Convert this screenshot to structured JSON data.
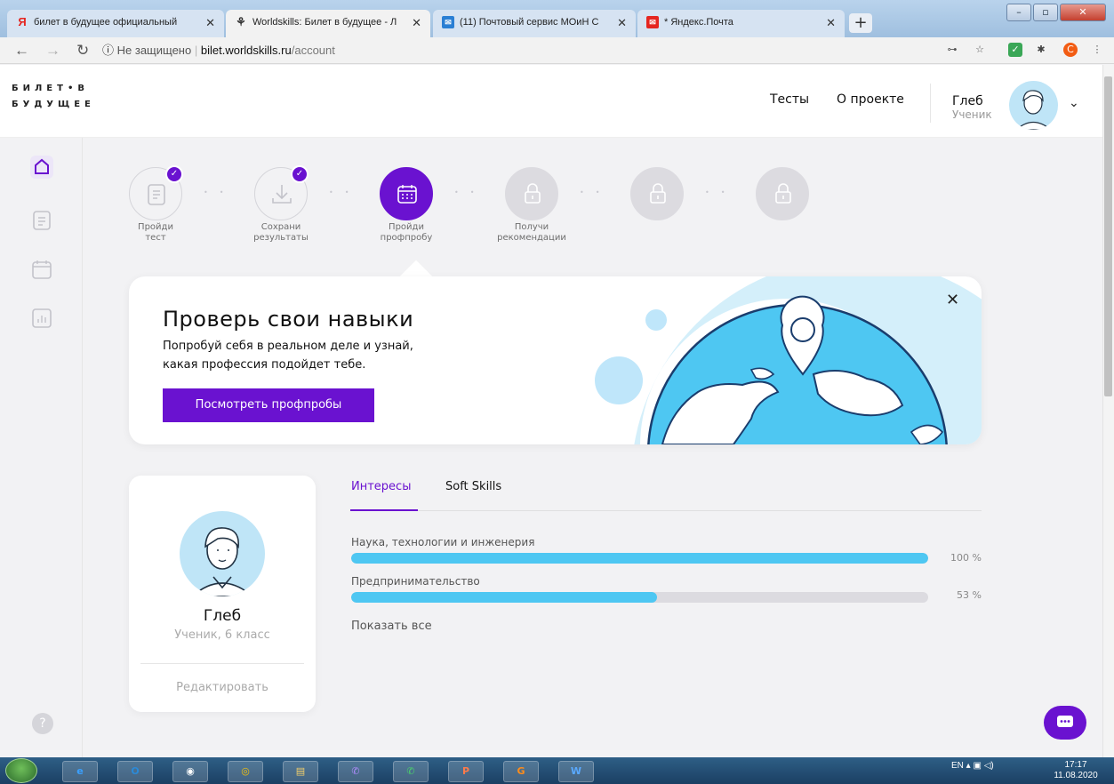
{
  "browser": {
    "tabs": [
      {
        "title": "билет в будущее официальный",
        "icon": "yandex-icon"
      },
      {
        "title": "Worldskills: Билет в будущее - Л",
        "icon": "worldskills-icon"
      },
      {
        "title": "(11) Почтовый сервис МОиН С",
        "icon": "mail-icon"
      },
      {
        "title": "* Яндекс.Почта",
        "icon": "yandex-mail-icon"
      }
    ],
    "address": {
      "security": "Не защищено",
      "host": "bilet.worldskills.ru",
      "path": "/account"
    }
  },
  "site": {
    "logo_line1": "БИЛЕТ•В",
    "logo_line2": "БУДУЩЕЕ",
    "nav": {
      "tests": "Тесты",
      "about": "О проекте"
    },
    "user": {
      "name": "Глеб",
      "role": "Ученик"
    }
  },
  "steps": [
    {
      "label1": "Пройди",
      "label2": "тест",
      "status": "done"
    },
    {
      "label1": "Сохрани",
      "label2": "результаты",
      "status": "done"
    },
    {
      "label1": "Пройди",
      "label2": "профпробу",
      "status": "current"
    },
    {
      "label1": "Получи",
      "label2": "рекомендации",
      "status": "locked"
    },
    {
      "label1": "",
      "label2": "",
      "status": "locked"
    },
    {
      "label1": "",
      "label2": "",
      "status": "locked"
    }
  ],
  "banner": {
    "title": "Проверь свои навыки",
    "text_line1": "Попробуй себя в реальном деле и узнай,",
    "text_line2": "какая профессия подойдет тебе.",
    "button": "Посмотреть профпробы"
  },
  "profile": {
    "name": "Глеб",
    "role": "Ученик, 6 класс",
    "edit": "Редактировать"
  },
  "tabs": {
    "interests": "Интересы",
    "soft_skills": "Soft Skills"
  },
  "interests": [
    {
      "label": "Наука, технологии и инженерия",
      "value": 100,
      "pct": "100 %"
    },
    {
      "label": "Предпринимательство",
      "value": 53,
      "pct": "53 %"
    }
  ],
  "show_all": "Показать все",
  "taskbar": {
    "lang": "EN",
    "time": "17:17",
    "date": "11.08.2020"
  },
  "colors": {
    "accent": "#6a12d0",
    "bar": "#4ec7f2",
    "track": "#dcdbe0"
  }
}
